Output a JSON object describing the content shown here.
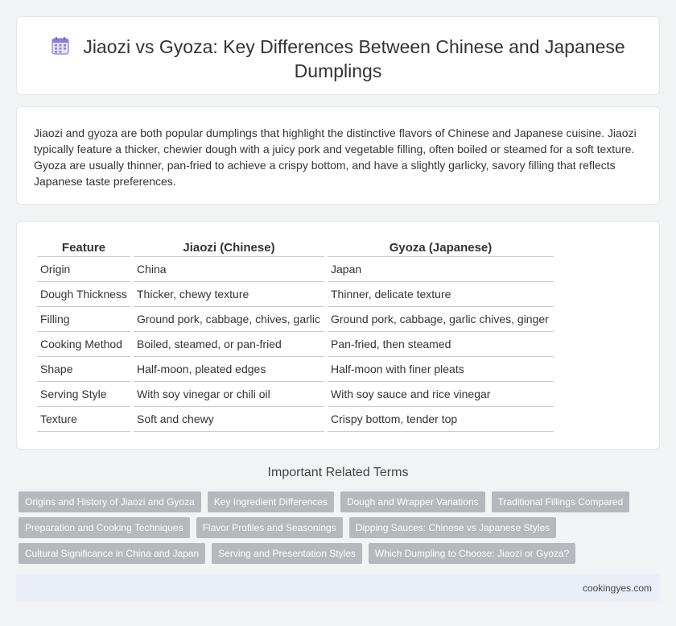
{
  "header": {
    "icon": "calendar-icon",
    "title": "Jiaozi vs Gyoza: Key Differences Between Chinese and Japanese Dumplings"
  },
  "intro": {
    "text": "Jiaozi and gyoza are both popular dumplings that highlight the distinctive flavors of Chinese and Japanese cuisine. Jiaozi typically feature a thicker, chewier dough with a juicy pork and vegetable filling, often boiled or steamed for a soft texture. Gyoza are usually thinner, pan-fried to achieve a crispy bottom, and have a slightly garlicky, savory filling that reflects Japanese taste preferences."
  },
  "table": {
    "headers": [
      "Feature",
      "Jiaozi (Chinese)",
      "Gyoza (Japanese)"
    ],
    "rows": [
      [
        "Origin",
        "China",
        "Japan"
      ],
      [
        "Dough Thickness",
        "Thicker, chewy texture",
        "Thinner, delicate texture"
      ],
      [
        "Filling",
        "Ground pork, cabbage, chives, garlic",
        "Ground pork, cabbage, garlic chives, ginger"
      ],
      [
        "Cooking Method",
        "Boiled, steamed, or pan-fried",
        "Pan-fried, then steamed"
      ],
      [
        "Shape",
        "Half-moon, pleated edges",
        "Half-moon with finer pleats"
      ],
      [
        "Serving Style",
        "With soy vinegar or chili oil",
        "With soy sauce and rice vinegar"
      ],
      [
        "Texture",
        "Soft and chewy",
        "Crispy bottom, tender top"
      ]
    ]
  },
  "related": {
    "title": "Important Related Terms",
    "tags": [
      [
        "Origins and History of Jiaozi and Gyoza",
        "Key Ingredient Differences",
        "Dough and Wrapper Variations",
        "Traditional Fillings Compared"
      ],
      [
        "Preparation and Cooking Techniques",
        "Flavor Profiles and Seasonings",
        "Dipping Sauces: Chinese vs Japanese Styles"
      ],
      [
        "Cultural Significance in China and Japan",
        "Serving and Presentation Styles",
        "Which Dumpling to Choose: Jiaozi or Gyoza?"
      ]
    ]
  },
  "footer": {
    "site": "cookingyes.com"
  },
  "colors": {
    "icon_accent": "#7b6fd6",
    "tag_bg": "#b5b8bd",
    "footer_bg": "#e9eef7"
  }
}
